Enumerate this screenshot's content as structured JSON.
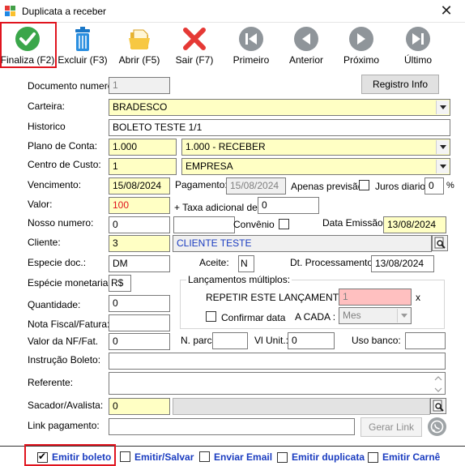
{
  "window": {
    "title": "Duplicata a receber",
    "close_glyph": "✕"
  },
  "toolbar": {
    "finaliza": "Finaliza (F2)",
    "excluir": "Excluir (F3)",
    "abrir": "Abrir (F5)",
    "sair": "Sair (F7)",
    "primeiro": "Primeiro",
    "anterior": "Anterior",
    "proximo": "Próximo",
    "ultimo": "Último"
  },
  "form": {
    "documento_label": "Documento numero:",
    "documento_value": "1",
    "registro_info_button": "Registro Info",
    "carteira_label": "Carteira:",
    "carteira_value": "BRADESCO",
    "historico_label": "Historico",
    "historico_value": "BOLETO TESTE 1/1",
    "plano_label": "Plano de Conta:",
    "plano_code": "1.000",
    "plano_value": "1.000 - RECEBER",
    "centro_label": "Centro de Custo:",
    "centro_code": "1",
    "centro_value": "EMPRESA",
    "vencimento_label": "Vencimento:",
    "vencimento_value": "15/08/2024",
    "pagamento_label": "Pagamento:",
    "pagamento_value": "15/08/2024",
    "apenas_previsao_label": "Apenas previsão",
    "juros_label": "Juros diario:",
    "juros_value": "0",
    "percent": "%",
    "valor_label": "Valor:",
    "valor_value": "100",
    "taxa_label": "+ Taxa adicional de:",
    "taxa_value": "0",
    "nosso_numero_label": "Nosso numero:",
    "nosso_numero_value": "0",
    "nosso_numero_extra": "",
    "convenio_label": "Convênio",
    "data_emissao_label": "Data Emissão:",
    "data_emissao_value": "13/08/2024",
    "cliente_label": "Cliente:",
    "cliente_code": "3",
    "cliente_value": "CLIENTE TESTE",
    "especie_doc_label": "Especie doc.:",
    "especie_doc_value": "DM",
    "aceite_label": "Aceite:",
    "aceite_value": "N",
    "dt_processamento_label": "Dt. Processamento:",
    "dt_processamento_value": "13/08/2024",
    "especie_monetaria_label": "Espécie monetaria:",
    "especie_monetaria_value": "R$",
    "lancamentos_title": "Lançamentos múltiplos:",
    "repetir_label": "REPETIR ESTE LANÇAMENTO:",
    "repetir_value": "1",
    "repetir_suffix": "x",
    "confirmar_data_label": "Confirmar data",
    "a_cada_label": "A CADA :",
    "a_cada_value": "Mes",
    "quantidade_label": "Quantidade:",
    "quantidade_value": "0",
    "nota_fiscal_label": "Nota Fiscal/Fatura:",
    "nota_fiscal_value": "",
    "valor_nf_label": "Valor da NF/Fat.",
    "valor_nf_value": "0",
    "n_parc_label": "N. parc:",
    "n_parc_value": "",
    "vl_unit_label": "Vl Unit.:",
    "vl_unit_value": "0",
    "uso_banco_label": "Uso banco:",
    "uso_banco_value": "",
    "instrucao_label": "Instrução Boleto:",
    "instrucao_value": "",
    "referente_label": "Referente:",
    "referente_value": "",
    "sacador_label": "Sacador/Avalista:",
    "sacador_code": "0",
    "sacador_value": "",
    "link_label": "Link pagamento:",
    "link_value": "",
    "gerar_link_button": "Gerar Link"
  },
  "bottom": {
    "emitir_boleto": "Emitir boleto",
    "emitir_salvar": "Emitir/Salvar",
    "enviar_email": "Enviar Email",
    "emitir_duplicata": "Emitir duplicata",
    "emitir_carne": "Emitir Carnê"
  },
  "colors": {
    "field_yellow": "#ffffc4",
    "highlight_red": "#e0141e",
    "link_blue": "#1a3cc0"
  }
}
